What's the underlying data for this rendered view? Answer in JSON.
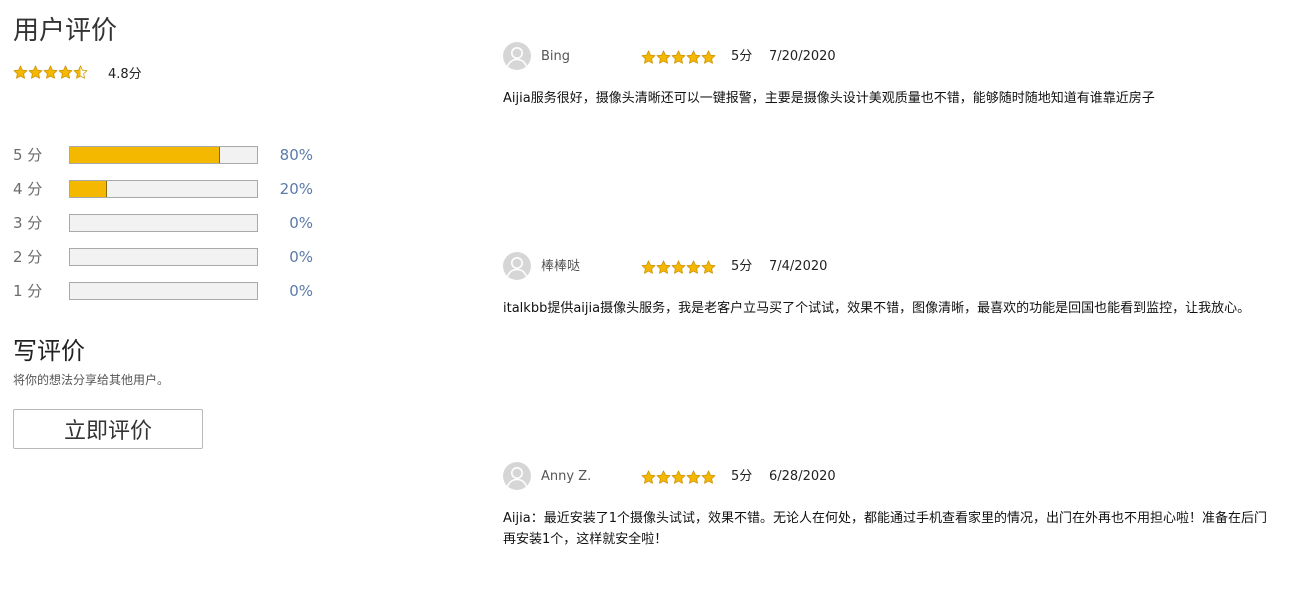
{
  "summary": {
    "title": "用户评价",
    "average_stars": 4.8,
    "average_text": "4.8分"
  },
  "histogram": [
    {
      "label": "5 分",
      "percent": 80,
      "percent_text": "80%"
    },
    {
      "label": "4 分",
      "percent": 20,
      "percent_text": "20%"
    },
    {
      "label": "3 分",
      "percent": 0,
      "percent_text": "0%"
    },
    {
      "label": "2 分",
      "percent": 0,
      "percent_text": "0%"
    },
    {
      "label": "1 分",
      "percent": 0,
      "percent_text": "0%"
    }
  ],
  "write": {
    "title": "写评价",
    "subtitle": "将你的想法分享给其他用户。",
    "button_label": "立即评价"
  },
  "reviews": [
    {
      "name": "Bing",
      "stars": 5,
      "score": "5分",
      "date": "7/20/2020",
      "text": "Aijia服务很好，摄像头清晰还可以一键报警，主要是摄像头设计美观质量也不错，能够随时随地知道有谁靠近房子"
    },
    {
      "name": "棒棒哒",
      "stars": 5,
      "score": "5分",
      "date": "7/4/2020",
      "text": "italkbb提供aijia摄像头服务，我是老客户立马买了个试试，效果不错，图像清晰，最喜欢的功能是回国也能看到监控，让我放心。"
    },
    {
      "name": "Anny Z.",
      "stars": 5,
      "score": "5分",
      "date": "6/28/2020",
      "text": "Aijia：最近安装了1个摄像头试试，效果不错。无论人在何处，都能通过手机查看家里的情况，出门在外再也不用担心啦！准备在后门再安装1个，这样就安全啦！"
    }
  ],
  "colors": {
    "star": "#f5b800",
    "bar_fill": "#f5b800",
    "bar_track": "#f2f2f2",
    "percent_text": "#5b7aa8",
    "avatar": "#d6d6d6"
  },
  "icons": {
    "star": "star-icon",
    "half_star": "star-half-icon",
    "avatar": "user-avatar-icon"
  }
}
